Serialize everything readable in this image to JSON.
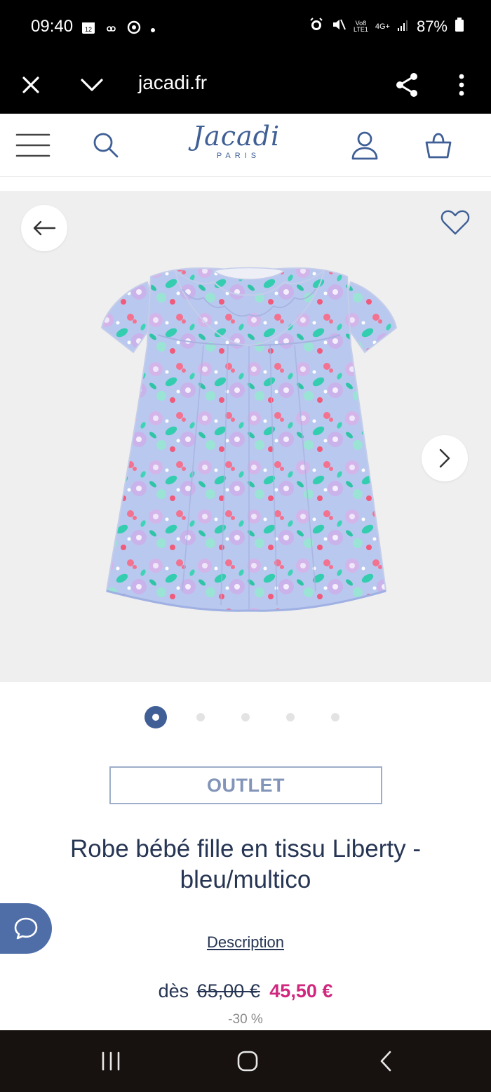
{
  "status_bar": {
    "time": "09:40",
    "battery": "87%",
    "network_top": "Vo8",
    "network_bottom": "LTE1",
    "network_type": "4G+"
  },
  "browser": {
    "url": "jacadi.fr"
  },
  "header": {
    "logo_text": "Jacadi",
    "logo_sub": "PARIS"
  },
  "gallery": {
    "total_images": 5,
    "active_index": 0
  },
  "product": {
    "badge": "OUTLET",
    "title_line1": "Robe bébé fille en tissu Liberty -",
    "title_line2": "bleu/multico",
    "description_link": "Description",
    "price_prefix": "dès",
    "price_old": "65,00 €",
    "price_new": "45,50 €",
    "discount": "-30 %"
  },
  "colors": {
    "brand_blue": "#3f5f96",
    "sale_pink": "#d0287e",
    "badge_border": "#9eadc9"
  }
}
